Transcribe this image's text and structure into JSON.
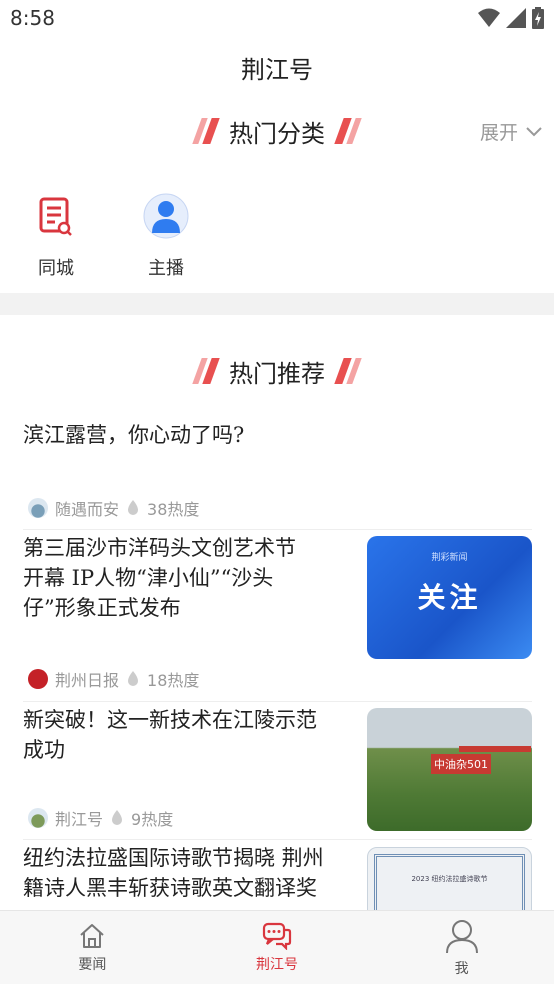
{
  "status": {
    "time": "8:58"
  },
  "app_title": "荆江号",
  "hot_categories": {
    "heading": "热门分类",
    "expand_label": "展开",
    "items": [
      {
        "label": "同城",
        "icon": "document-pen-icon"
      },
      {
        "label": "主播",
        "icon": "anchor-person-icon"
      }
    ]
  },
  "hot_recommend": {
    "heading": "热门推荐",
    "articles": [
      {
        "title_lines": [
          "滨江露营，你心动了吗?"
        ],
        "source": "随遇而安",
        "heat": "38热度",
        "has_thumb": false
      },
      {
        "title_lines": [
          "第三届沙市洋码头文创艺术节",
          "开幕 IP人物“津小仙”“沙头",
          "仔”形象正式发布"
        ],
        "source": "荆州日报",
        "heat": "18热度",
        "has_thumb": true,
        "thumb_text": "关注",
        "thumb_small": "荆彩新闻"
      },
      {
        "title_lines": [
          "新突破！这一新技术在江陵示范",
          "成功"
        ],
        "source": "荆江号",
        "heat": "9热度",
        "has_thumb": true,
        "thumb_text": "中油杂501"
      },
      {
        "title_lines": [
          "纽约法拉盛国际诗歌节揭晓 荆州",
          "籍诗人黑丰斩获诗歌英文翻译奖"
        ],
        "has_thumb": true,
        "thumb_text": "2023 纽约法拉盛诗歌节"
      }
    ]
  },
  "tabbar": {
    "items": [
      {
        "label": "要闻",
        "icon": "home-icon",
        "active": false
      },
      {
        "label": "荆江号",
        "icon": "chat-bubbles-icon",
        "active": true
      },
      {
        "label": "我",
        "icon": "person-icon",
        "active": false
      }
    ]
  },
  "colors": {
    "accent": "#d9363e",
    "slash_light": "#f4a3a3",
    "slash_dark": "#e85050"
  }
}
